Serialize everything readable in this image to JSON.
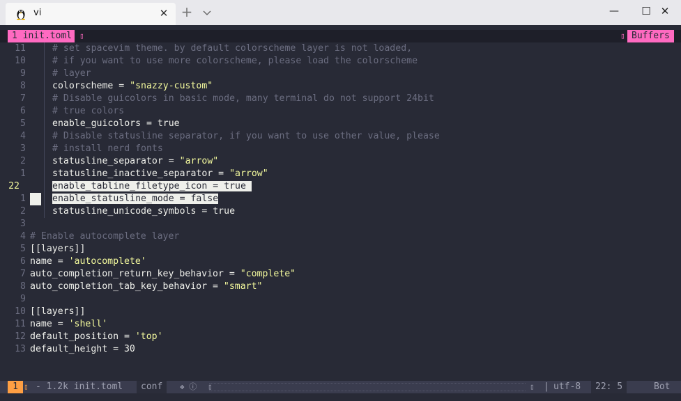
{
  "window": {
    "tab_title": "vi",
    "tab_close_glyph": "✕",
    "new_tab_glyph": "+",
    "dropdown_icon": "chevron-down-icon",
    "minimize_glyph": "—",
    "maximize_glyph": "☐",
    "close_glyph": "✕"
  },
  "tabline": {
    "current_tab": "1 init.toml",
    "separator": "▯",
    "buffers_label": "Buffers"
  },
  "editor": {
    "lines": [
      {
        "nr": "11",
        "text": "# set spacevim theme. by default colorscheme layer is not loaded,"
      },
      {
        "nr": "10",
        "text": "# if you want to use more colorscheme, please load the colorscheme"
      },
      {
        "nr": "9",
        "text": "# layer"
      },
      {
        "nr": "8",
        "key": "colorscheme = ",
        "str": "\"snazzy-custom\""
      },
      {
        "nr": "7",
        "text": "# Disable guicolors in basic mode, many terminal do not support 24bit"
      },
      {
        "nr": "6",
        "text": "# true colors"
      },
      {
        "nr": "5",
        "key": "enable_guicolors = true"
      },
      {
        "nr": "4",
        "text": "# Disable statusline separator, if you want to use other value, please"
      },
      {
        "nr": "3",
        "text": "# install nerd fonts"
      },
      {
        "nr": "2",
        "key": "statusline_separator = ",
        "str": "\"arrow\""
      },
      {
        "nr": "1",
        "key": "statusline_inactive_separator = ",
        "str": "\"arrow\""
      },
      {
        "nr": "22",
        "key": "enable_tabline_filetype_icon = true "
      },
      {
        "nr": "1",
        "key": "enable_statusline_mode = false"
      },
      {
        "nr": "2",
        "key": "statusline_unicode_symbols = true"
      },
      {
        "nr": "3",
        "key": ""
      },
      {
        "nr": "4",
        "text": "# Enable autocomplete layer"
      },
      {
        "nr": "5",
        "key": "[[layers]]"
      },
      {
        "nr": "6",
        "key": "name = ",
        "str": "'autocomplete'"
      },
      {
        "nr": "7",
        "key": "auto_completion_return_key_behavior = ",
        "str": "\"complete\""
      },
      {
        "nr": "8",
        "key": "auto_completion_tab_key_behavior = ",
        "str": "\"smart\""
      },
      {
        "nr": "9",
        "key": ""
      },
      {
        "nr": "10",
        "key": "[[layers]]"
      },
      {
        "nr": "11",
        "key": "name = ",
        "str": "'shell'"
      },
      {
        "nr": "12",
        "key": "default_position = ",
        "str": "'top'"
      },
      {
        "nr": "13",
        "key": "default_height = 30"
      }
    ]
  },
  "statusline": {
    "mode": "1",
    "mode_sep": "▯",
    "file_info": "- 1.2k init.toml",
    "filetype": "conf",
    "icons": "❖ ⓘ",
    "right_sep": "▯",
    "pipe": "|",
    "encoding": "utf-8",
    "position": "22:  5",
    "percent": "Bot"
  },
  "colors": {
    "background": "#282a36",
    "accent_pink": "#ff6ac1",
    "mode_orange": "#ff9f43",
    "string_yellow": "#f3f99d",
    "comment_gray": "#6b6d80",
    "foreground": "#eff0eb"
  }
}
